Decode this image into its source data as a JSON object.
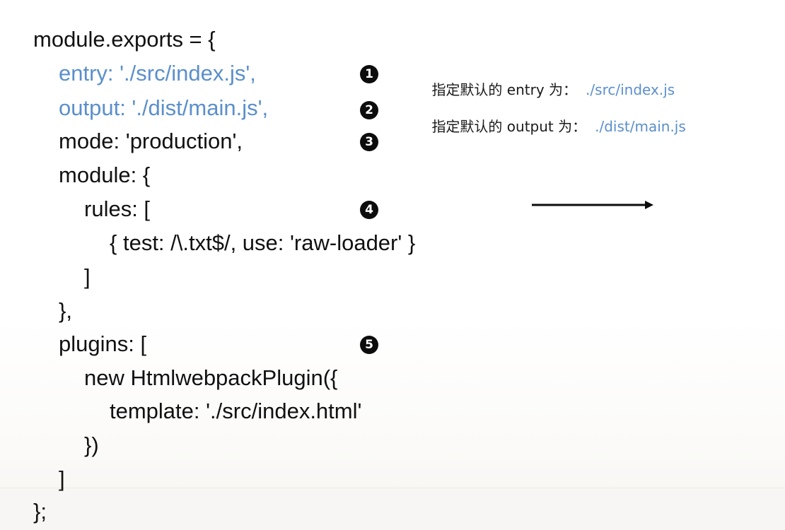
{
  "code": {
    "lines": [
      "module.exports = {",
      "entry: './src/index.js',",
      "output: './dist/main.js',",
      "mode: 'production',",
      "module: {",
      "rules: [",
      "{ test: /\\.txt$/, use: 'raw-loader' }",
      "]",
      "},",
      "plugins: [",
      "new HtmlwebpackPlugin({",
      "template: './src/index.html'",
      "})",
      "]",
      "};"
    ]
  },
  "badges": [
    "1",
    "2",
    "3",
    "4",
    "5"
  ],
  "notes": [
    {
      "label": "指定默认的 entry 为：",
      "path": "./src/index.js"
    },
    {
      "label": "指定默认的 output 为：",
      "path": "./dist/main.js"
    }
  ],
  "colors": {
    "accent": "#5b8fcb",
    "text": "#111111",
    "badge": "#0c0c0c"
  },
  "icons": {
    "arrow": "right-arrow-icon"
  }
}
